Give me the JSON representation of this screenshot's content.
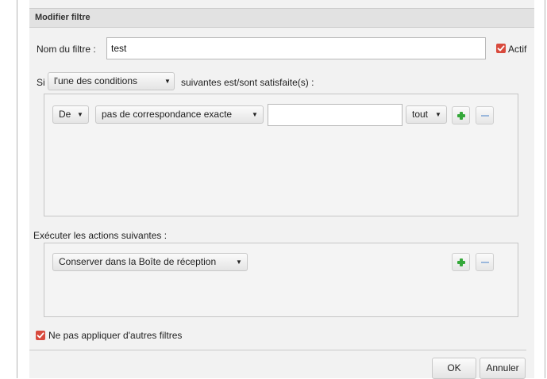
{
  "dialog": {
    "title": "Modifier filtre"
  },
  "filter_name": {
    "label": "Nom du filtre :",
    "value": "test"
  },
  "active": {
    "label": "Actif",
    "checked": true
  },
  "conditions": {
    "prefix": "Si",
    "mode_selected": "l'une des conditions",
    "suffix": "suivantes est/sont satisfaite(s) :",
    "rows": [
      {
        "field": "De",
        "operator": "pas de correspondance exacte",
        "value": "",
        "scope": "tout"
      }
    ]
  },
  "actions": {
    "heading": "Exécuter les actions suivantes :",
    "rows": [
      {
        "action": "Conserver dans la Boîte de réception"
      }
    ]
  },
  "stop_processing": {
    "label": "Ne pas appliquer d'autres filtres",
    "checked": true
  },
  "footer": {
    "ok_label": "OK",
    "cancel_label": "Annuler"
  },
  "colors": {
    "checkbox": "#d84a3d",
    "add_icon": "#35a83a",
    "remove_icon": "#9bb8dc",
    "titlebar": "#e2e2e2"
  }
}
